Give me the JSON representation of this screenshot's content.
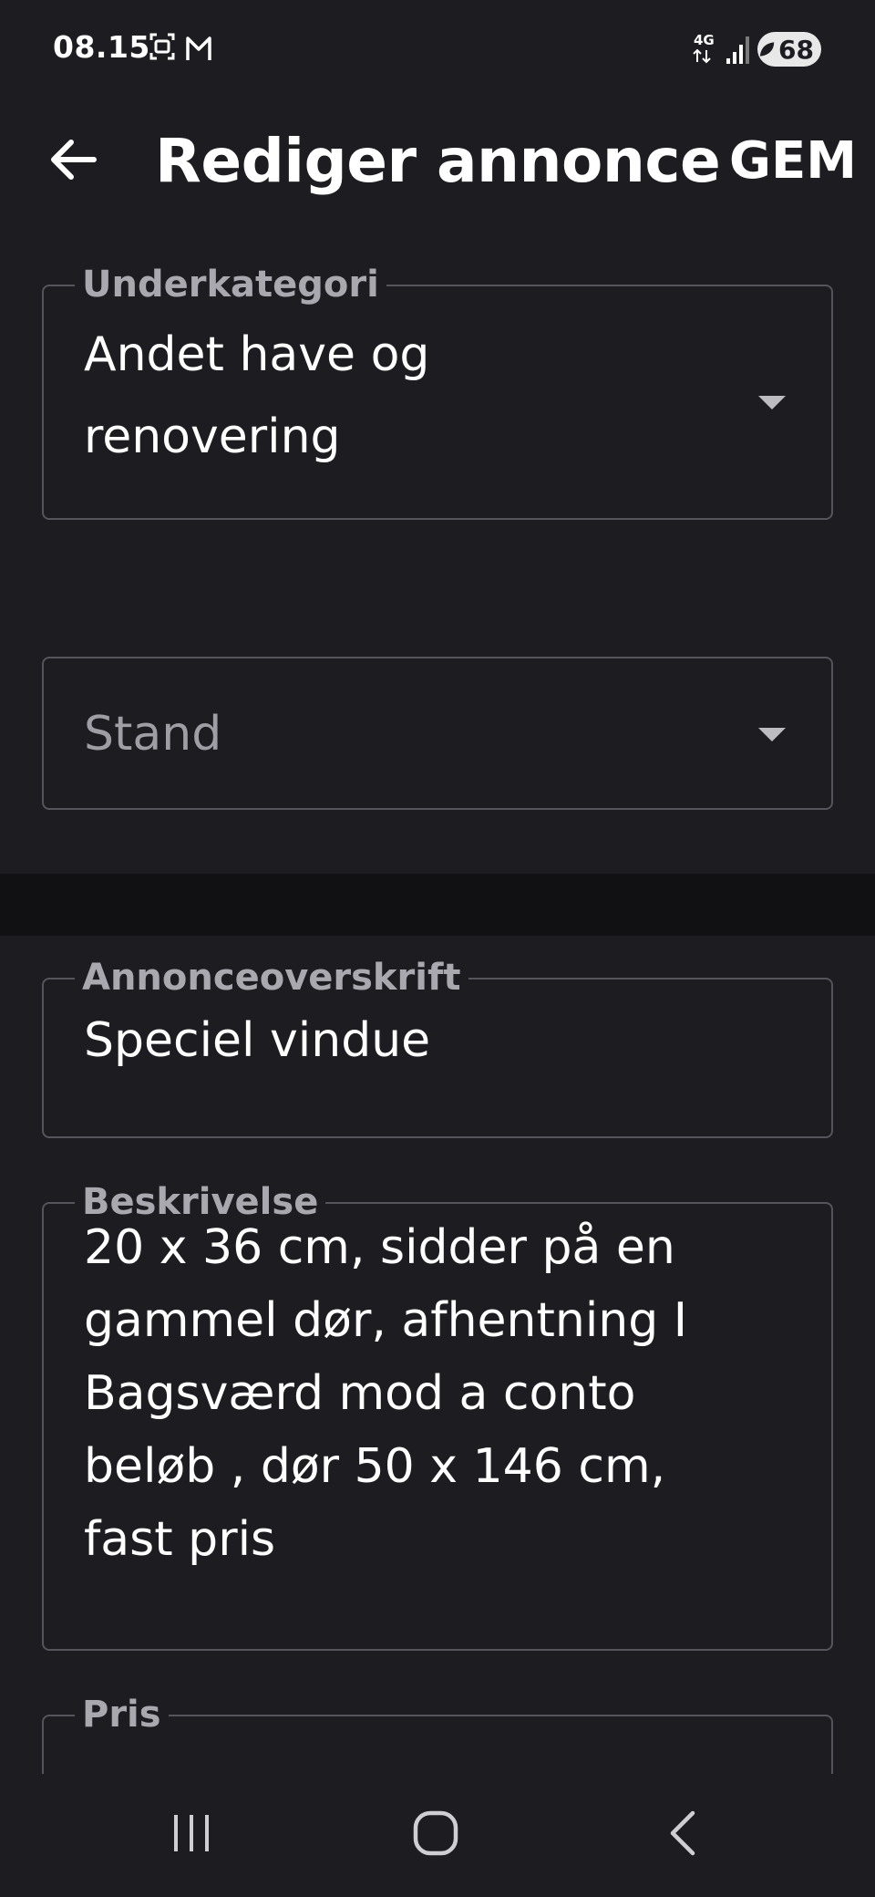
{
  "status_bar": {
    "time": "08.15",
    "network": "4G",
    "battery": "68",
    "left_icons": [
      "screenshot-icon",
      "gmail-icon"
    ],
    "right_icons": [
      "network-4g-icon",
      "signal-icon",
      "battery-icon"
    ]
  },
  "toolbar": {
    "title": "Rediger annonce",
    "save_label": "GEM",
    "back_icon": "arrow-left-icon"
  },
  "form": {
    "subcategory": {
      "label": "Underkategori",
      "value_line1": "Andet have og",
      "value_line2": "renovering"
    },
    "condition": {
      "placeholder": "Stand"
    },
    "headline": {
      "label": "Annonceoverskrift",
      "value": "Speciel vindue"
    },
    "description": {
      "label": "Beskrivelse",
      "lines": [
        "20 x 36 cm, sidder på en",
        "gammel dør, afhentning I",
        "Bagsværd mod a conto",
        "beløb ,  dør 50 x 146 cm,",
        "fast pris"
      ]
    },
    "price": {
      "label": "Pris"
    }
  },
  "navigation": {
    "recents_icon": "recents-icon",
    "home_icon": "home-icon",
    "back_icon": "back-chevron-icon"
  },
  "colors": {
    "background": "#1d1c21",
    "divider": "#111113",
    "border": "#55545b",
    "label": "#a9a8ae",
    "text": "#ffffff"
  }
}
